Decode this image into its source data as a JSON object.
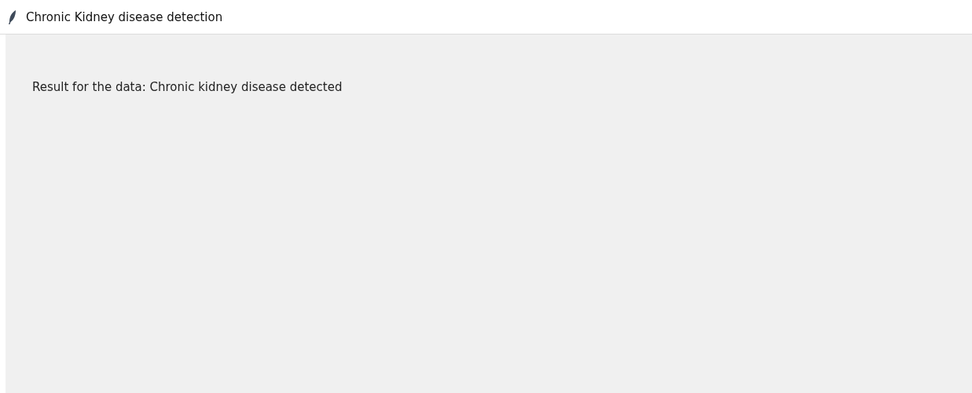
{
  "window": {
    "title": "Chronic Kidney disease detection"
  },
  "content": {
    "result_label": "Result for the data: Chronic kidney disease detected"
  }
}
